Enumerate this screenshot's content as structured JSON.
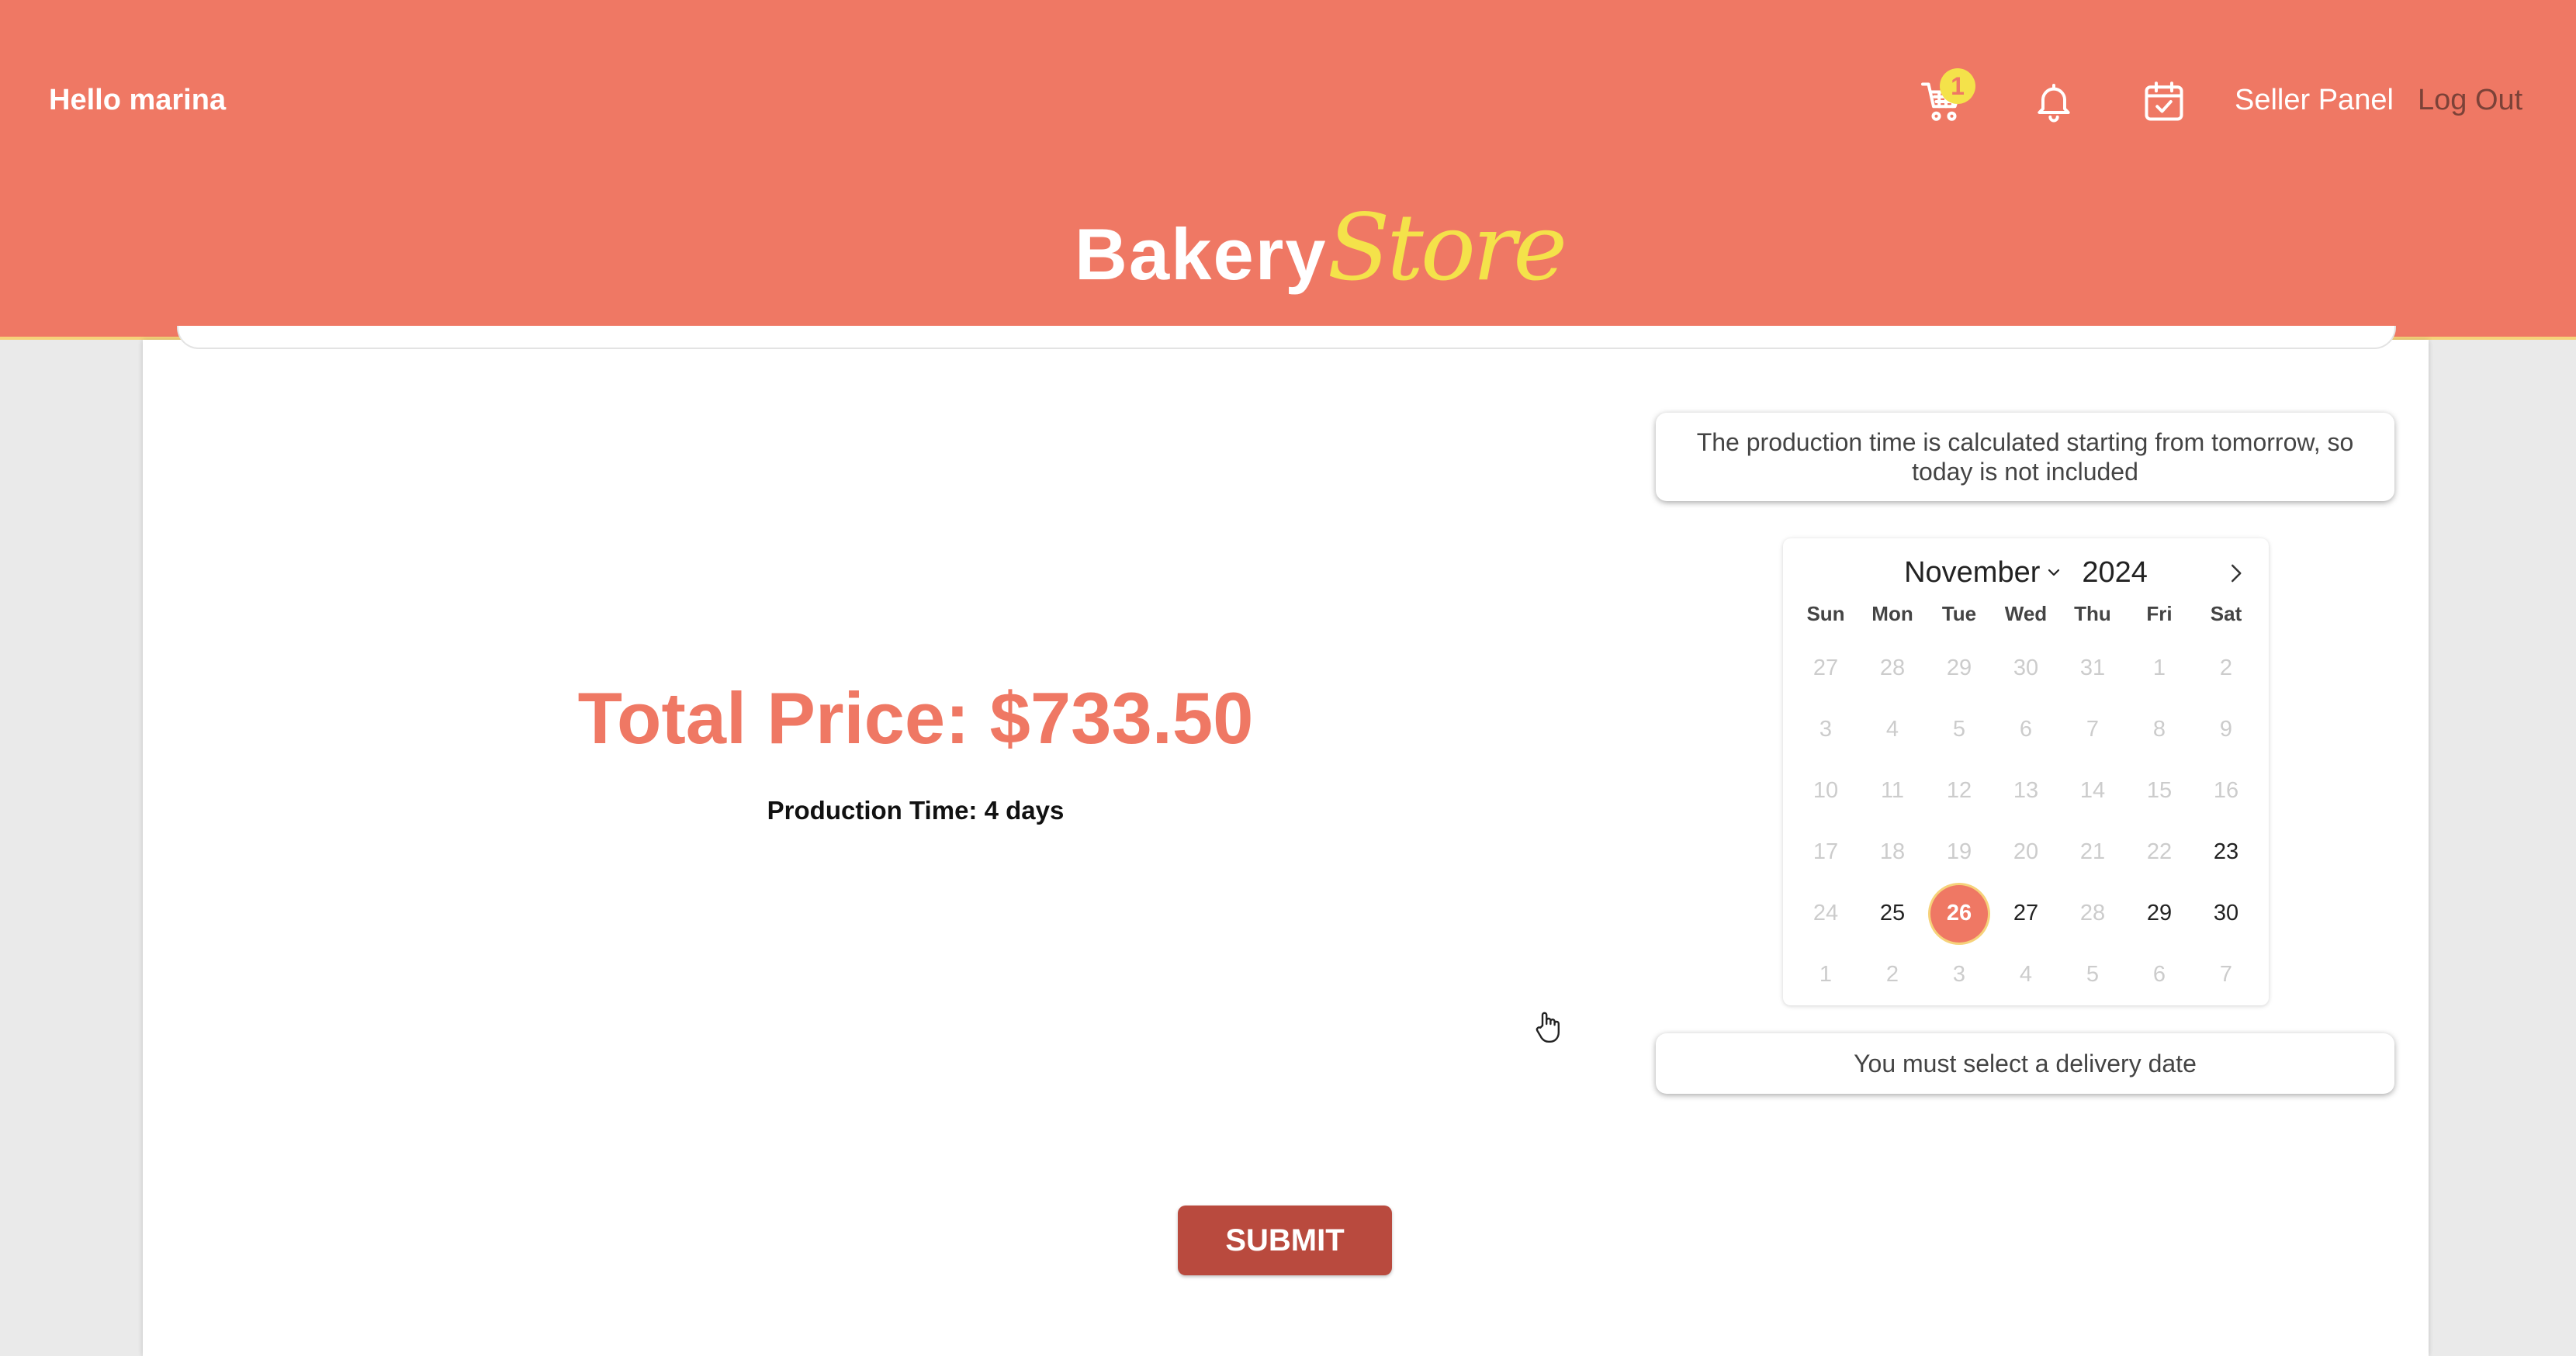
{
  "header": {
    "greeting": "Hello marina",
    "cart_count": "1",
    "icons": [
      "cart-icon",
      "bell-icon",
      "calendar-check-icon"
    ],
    "seller_panel": "Seller Panel",
    "logout": "Log Out",
    "logo_main": "Bakery",
    "logo_accent": "Store",
    "colors": {
      "header_bg": "#ef7864",
      "accent": "#f4e24a",
      "logout_text": "#7c4238"
    }
  },
  "main": {
    "total_price": "Total Price: $733.50",
    "production_time": "Production Time: 4 days",
    "info_note": "The production time is calculated starting from tomorrow, so today is not included",
    "validation_message": "You must select a delivery date",
    "submit_label": "SUBMIT",
    "colors": {
      "price": "#ef7864",
      "submit_bg": "#b94a3e"
    }
  },
  "calendar": {
    "month": "November",
    "year": "2024",
    "weekdays": [
      "Sun",
      "Mon",
      "Tue",
      "Wed",
      "Thu",
      "Fri",
      "Sat"
    ],
    "weeks": [
      [
        {
          "d": "27",
          "s": "disabled"
        },
        {
          "d": "28",
          "s": "disabled"
        },
        {
          "d": "29",
          "s": "disabled"
        },
        {
          "d": "30",
          "s": "disabled"
        },
        {
          "d": "31",
          "s": "disabled"
        },
        {
          "d": "1",
          "s": "disabled"
        },
        {
          "d": "2",
          "s": "disabled"
        }
      ],
      [
        {
          "d": "3",
          "s": "disabled"
        },
        {
          "d": "4",
          "s": "disabled"
        },
        {
          "d": "5",
          "s": "disabled"
        },
        {
          "d": "6",
          "s": "disabled"
        },
        {
          "d": "7",
          "s": "disabled"
        },
        {
          "d": "8",
          "s": "disabled"
        },
        {
          "d": "9",
          "s": "disabled"
        }
      ],
      [
        {
          "d": "10",
          "s": "disabled"
        },
        {
          "d": "11",
          "s": "disabled"
        },
        {
          "d": "12",
          "s": "disabled"
        },
        {
          "d": "13",
          "s": "disabled"
        },
        {
          "d": "14",
          "s": "disabled"
        },
        {
          "d": "15",
          "s": "disabled"
        },
        {
          "d": "16",
          "s": "disabled"
        }
      ],
      [
        {
          "d": "17",
          "s": "disabled"
        },
        {
          "d": "18",
          "s": "disabled"
        },
        {
          "d": "19",
          "s": "disabled"
        },
        {
          "d": "20",
          "s": "disabled"
        },
        {
          "d": "21",
          "s": "disabled"
        },
        {
          "d": "22",
          "s": "disabled"
        },
        {
          "d": "23",
          "s": "enabled"
        }
      ],
      [
        {
          "d": "24",
          "s": "disabled"
        },
        {
          "d": "25",
          "s": "enabled"
        },
        {
          "d": "26",
          "s": "selected"
        },
        {
          "d": "27",
          "s": "enabled"
        },
        {
          "d": "28",
          "s": "disabled"
        },
        {
          "d": "29",
          "s": "enabled"
        },
        {
          "d": "30",
          "s": "enabled"
        }
      ],
      [
        {
          "d": "1",
          "s": "disabled"
        },
        {
          "d": "2",
          "s": "disabled"
        },
        {
          "d": "3",
          "s": "disabled"
        },
        {
          "d": "4",
          "s": "disabled"
        },
        {
          "d": "5",
          "s": "disabled"
        },
        {
          "d": "6",
          "s": "disabled"
        },
        {
          "d": "7",
          "s": "disabled"
        }
      ]
    ],
    "colors": {
      "selected_bg": "#ef7864",
      "disabled_text": "#cccccc"
    }
  }
}
